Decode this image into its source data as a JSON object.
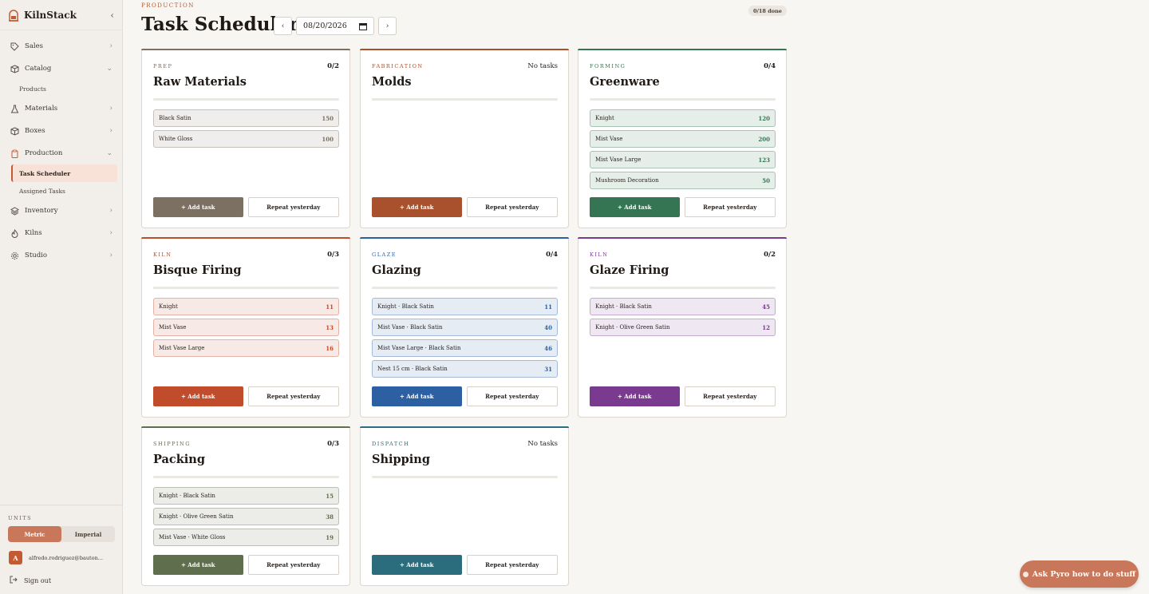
{
  "app": {
    "name": "KilnStack"
  },
  "sidebar": {
    "items": [
      {
        "label": "Sales",
        "icon": "tag-icon",
        "chev": "›"
      },
      {
        "label": "Catalog",
        "icon": "box-icon",
        "chev": "⌄"
      },
      {
        "label": "Products"
      },
      {
        "label": "Materials",
        "icon": "flask-icon",
        "chev": "›"
      },
      {
        "label": "Boxes",
        "icon": "package-icon",
        "chev": "›"
      },
      {
        "label": "Production",
        "icon": "clipboard-icon",
        "chev": "⌄"
      },
      {
        "label": "Task Scheduler"
      },
      {
        "label": "Assigned Tasks"
      },
      {
        "label": "Inventory",
        "icon": "layers-icon",
        "chev": "›"
      },
      {
        "label": "Kilns",
        "icon": "flame-icon",
        "chev": "›"
      },
      {
        "label": "Studio",
        "icon": "gear-icon",
        "chev": "›"
      }
    ],
    "units_label": "UNITS",
    "units": [
      "Metric",
      "Imperial"
    ],
    "user_initial": "A",
    "user_email": "alfredo.rodriguez@bauton...",
    "signout": "Sign out"
  },
  "header": {
    "eyebrow": "PRODUCTION",
    "title": "Task Scheduler",
    "date": "08/20/2026",
    "prev": "‹",
    "next": "›",
    "done": "0/18 done"
  },
  "cards": [
    {
      "cat": "PREP",
      "title": "Raw Materials",
      "count": "0/2",
      "color": "#7b7062",
      "tasks": [
        {
          "name": "Black Satin",
          "qty": "150"
        },
        {
          "name": "White Gloss",
          "qty": "100"
        }
      ],
      "add": "+ Add task",
      "repeat": "Repeat yesterday"
    },
    {
      "cat": "FABRICATION",
      "title": "Molds",
      "count": "No tasks",
      "color": "#a9512c",
      "tasks": [],
      "add": "+ Add task",
      "repeat": "Repeat yesterday"
    },
    {
      "cat": "FORMING",
      "title": "Greenware",
      "count": "0/4",
      "color": "#357554",
      "tasks": [
        {
          "name": "Knight",
          "qty": "120"
        },
        {
          "name": "Mist Vase",
          "qty": "200"
        },
        {
          "name": "Mist Vase Large",
          "qty": "123"
        },
        {
          "name": "Mushroom Decoration",
          "qty": "50"
        }
      ],
      "add": "+ Add task",
      "repeat": "Repeat yesterday"
    },
    {
      "cat": "KILN",
      "title": "Bisque Firing",
      "count": "0/3",
      "color": "#c04c2b",
      "tasks": [
        {
          "name": "Knight",
          "qty": "11"
        },
        {
          "name": "Mist Vase",
          "qty": "13"
        },
        {
          "name": "Mist Vase Large",
          "qty": "16"
        }
      ],
      "add": "+ Add task",
      "repeat": "Repeat yesterday"
    },
    {
      "cat": "GLAZE",
      "title": "Glazing",
      "count": "0/4",
      "color": "#2d5fa3",
      "tasks": [
        {
          "name": "Knight · Black Satin",
          "qty": "11"
        },
        {
          "name": "Mist Vase · Black Satin",
          "qty": "40"
        },
        {
          "name": "Mist Vase Large · Black Satin",
          "qty": "46"
        },
        {
          "name": "Nest 15 cm · Black Satin",
          "qty": "31"
        }
      ],
      "add": "+ Add task",
      "repeat": "Repeat yesterday"
    },
    {
      "cat": "KILN",
      "title": "Glaze Firing",
      "count": "0/2",
      "color": "#7a3a8f",
      "tasks": [
        {
          "name": "Knight · Black Satin",
          "qty": "45"
        },
        {
          "name": "Knight · Olive Green Satin",
          "qty": "12"
        }
      ],
      "add": "+ Add task",
      "repeat": "Repeat yesterday"
    },
    {
      "cat": "SHIPPING",
      "title": "Packing",
      "count": "0/3",
      "color": "#5f6e4d",
      "tasks": [
        {
          "name": "Knight · Black Satin",
          "qty": "15"
        },
        {
          "name": "Knight · Olive Green Satin",
          "qty": "38"
        },
        {
          "name": "Mist Vase · White Gloss",
          "qty": "19"
        }
      ],
      "add": "+ Add task",
      "repeat": "Repeat yesterday"
    },
    {
      "cat": "DISPATCH",
      "title": "Shipping",
      "count": "No tasks",
      "color": "#2b6c7d",
      "tasks": [],
      "add": "+ Add task",
      "repeat": "Repeat yesterday"
    }
  ],
  "assistant": {
    "label": "Ask Pyro how to do stuff"
  }
}
